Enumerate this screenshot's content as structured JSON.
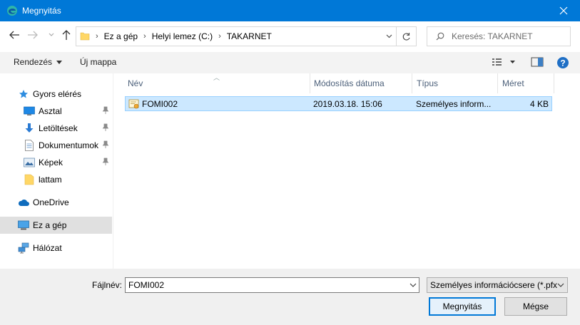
{
  "window": {
    "title": "Megnyitás"
  },
  "nav": {
    "breadcrumb": [
      "Ez a gép",
      "Helyi lemez (C:)",
      "TAKARNET"
    ],
    "search_placeholder": "Keresés: TAKARNET"
  },
  "toolbar": {
    "organize_label": "Rendezés",
    "new_folder_label": "Új mappa"
  },
  "sidebar": {
    "items": [
      {
        "label": "Gyors elérés",
        "icon": "star-icon"
      },
      {
        "label": "Asztal",
        "icon": "desktop-icon",
        "pinned": true
      },
      {
        "label": "Letöltések",
        "icon": "download-icon",
        "pinned": true
      },
      {
        "label": "Dokumentumok",
        "icon": "document-icon",
        "pinned": true
      },
      {
        "label": "Képek",
        "icon": "pictures-icon",
        "pinned": true
      },
      {
        "label": "lattam",
        "icon": "folder-icon"
      },
      {
        "label": "OneDrive",
        "icon": "cloud-icon"
      },
      {
        "label": "Ez a gép",
        "icon": "computer-icon",
        "selected": true
      },
      {
        "label": "Hálózat",
        "icon": "network-icon"
      }
    ]
  },
  "columns": {
    "name": "Név",
    "modified": "Módosítás dátuma",
    "type": "Típus",
    "size": "Méret"
  },
  "files": [
    {
      "name": "FOMI002",
      "modified": "2019.03.18. 15:06",
      "type": "Személyes inform...",
      "size": "4 KB"
    }
  ],
  "bottom": {
    "filename_label": "Fájlnév:",
    "filename_value": "FOMI002",
    "filetype_value": "Személyes információcsere (*.pfx",
    "open_label": "Megnyitás",
    "cancel_label": "Mégse"
  },
  "colors": {
    "accent": "#0078d7",
    "selection": "#cce8ff",
    "selection_border": "#99d1ff"
  }
}
